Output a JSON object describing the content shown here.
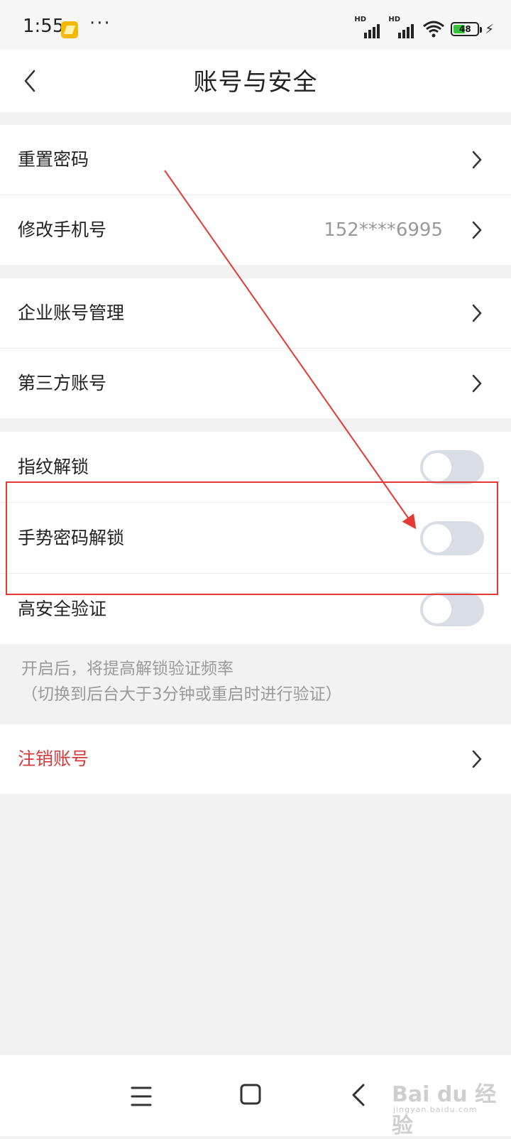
{
  "status_bar": {
    "time": "1:55",
    "more": "···",
    "signal_badge": "HD",
    "battery_level": "48",
    "battery_percent": 48,
    "notification_icon": "gallery-icon"
  },
  "header": {
    "title": "账号与安全",
    "back_icon": "chevron-left-icon"
  },
  "group_account": {
    "items": [
      {
        "label": "重置密码",
        "value": ""
      },
      {
        "label": "修改手机号",
        "value": "152****6995"
      }
    ]
  },
  "group_linked": {
    "items": [
      {
        "label": "企业账号管理"
      },
      {
        "label": "第三方账号"
      }
    ]
  },
  "group_security": {
    "items": [
      {
        "label": "指纹解锁",
        "enabled": false
      },
      {
        "label": "手势密码解锁",
        "enabled": false
      },
      {
        "label": "高安全验证",
        "enabled": false
      }
    ]
  },
  "hint": {
    "line1": "开启后，将提高解锁验证频率",
    "line2": "（切换到后台大于3分钟或重启时进行验证）"
  },
  "group_danger": {
    "items": [
      {
        "label": "注销账号"
      }
    ]
  },
  "nav_bar": {
    "menu_icon": "menu-icon",
    "home_icon": "home-square-icon",
    "back_icon": "back-triangle-icon"
  },
  "watermark": {
    "text": "Bai du 经验",
    "sub": "jingyan.baidu.com"
  },
  "colors": {
    "danger": "#d43a3a",
    "annotation": "#e53935",
    "toggle_off": "#d8dde6"
  }
}
